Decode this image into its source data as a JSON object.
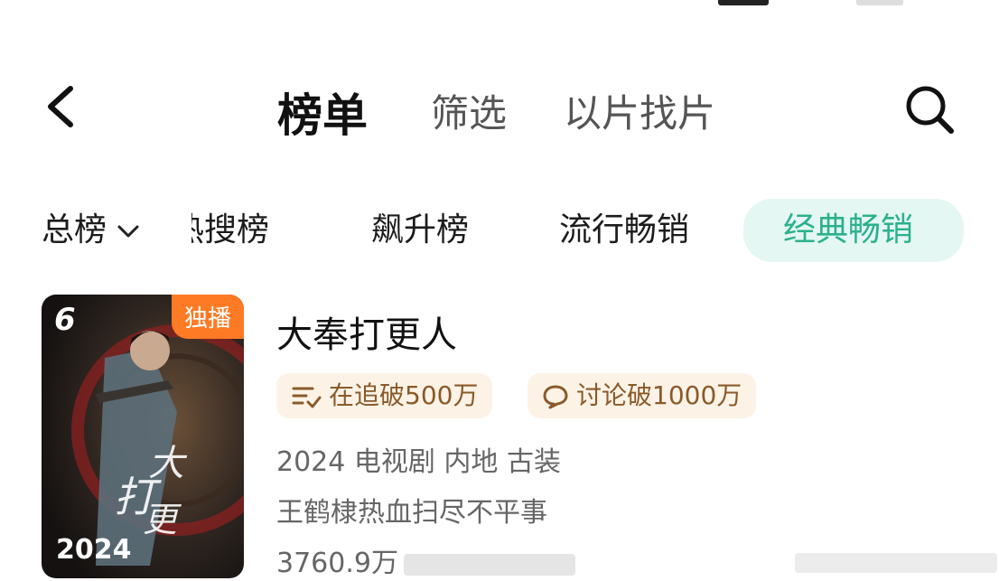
{
  "header": {
    "title": "榜单",
    "tabs": [
      "筛选",
      "以片找片"
    ]
  },
  "filters": {
    "total": "总榜",
    "chips": [
      "热搜榜",
      "飙升榜",
      "流行畅销"
    ],
    "active": "经典畅销"
  },
  "item": {
    "rank": "6",
    "badge": "独播",
    "poster_year": "2024",
    "title": "大奉打更人",
    "tags": [
      "在追破500万",
      "讨论破1000万"
    ],
    "meta": "2024 电视剧 内地 古装",
    "desc": "王鹤棣热血扫尽不平事",
    "count": "3760.9万"
  },
  "colors": {
    "accent": "#2bb18c",
    "accent_bg": "#e4f7f2",
    "badge": "#ff7a24",
    "tag_bg": "#fcf3e6",
    "tag_text": "#8a5a2a"
  }
}
